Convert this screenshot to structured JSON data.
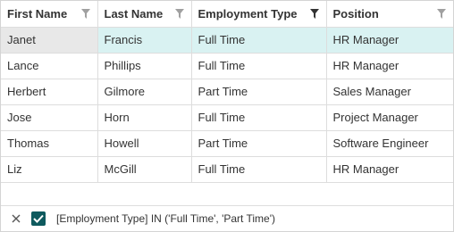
{
  "columns": [
    {
      "label": "First Name",
      "filter_active": false
    },
    {
      "label": "Last Name",
      "filter_active": false
    },
    {
      "label": "Employment Type",
      "filter_active": true
    },
    {
      "label": "Position",
      "filter_active": false
    }
  ],
  "rows": [
    [
      "Janet",
      "Francis",
      "Full Time",
      "HR Manager"
    ],
    [
      "Lance",
      "Phillips",
      "Full Time",
      "HR Manager"
    ],
    [
      "Herbert",
      "Gilmore",
      "Part Time",
      "Sales Manager"
    ],
    [
      "Jose",
      "Horn",
      "Full Time",
      "Project Manager"
    ],
    [
      "Thomas",
      "Howell",
      "Part Time",
      "Software Engineer"
    ],
    [
      "Liz",
      "McGill",
      "Full Time",
      "HR Manager"
    ]
  ],
  "filter_panel": {
    "enabled": true,
    "expression": "[Employment Type] IN ('Full Time', 'Part Time')"
  },
  "colors": {
    "focused_row": "#d9f2f2",
    "focused_cell": "#e8e8e8",
    "filter_icon_inactive": "#a0a0a0",
    "filter_icon_active": "#333333",
    "checkbox": "#0e5a5e"
  },
  "icons": {
    "column_filter": "funnel-icon",
    "clear_filter": "close-icon",
    "enable_filter": "checkmark-icon"
  }
}
